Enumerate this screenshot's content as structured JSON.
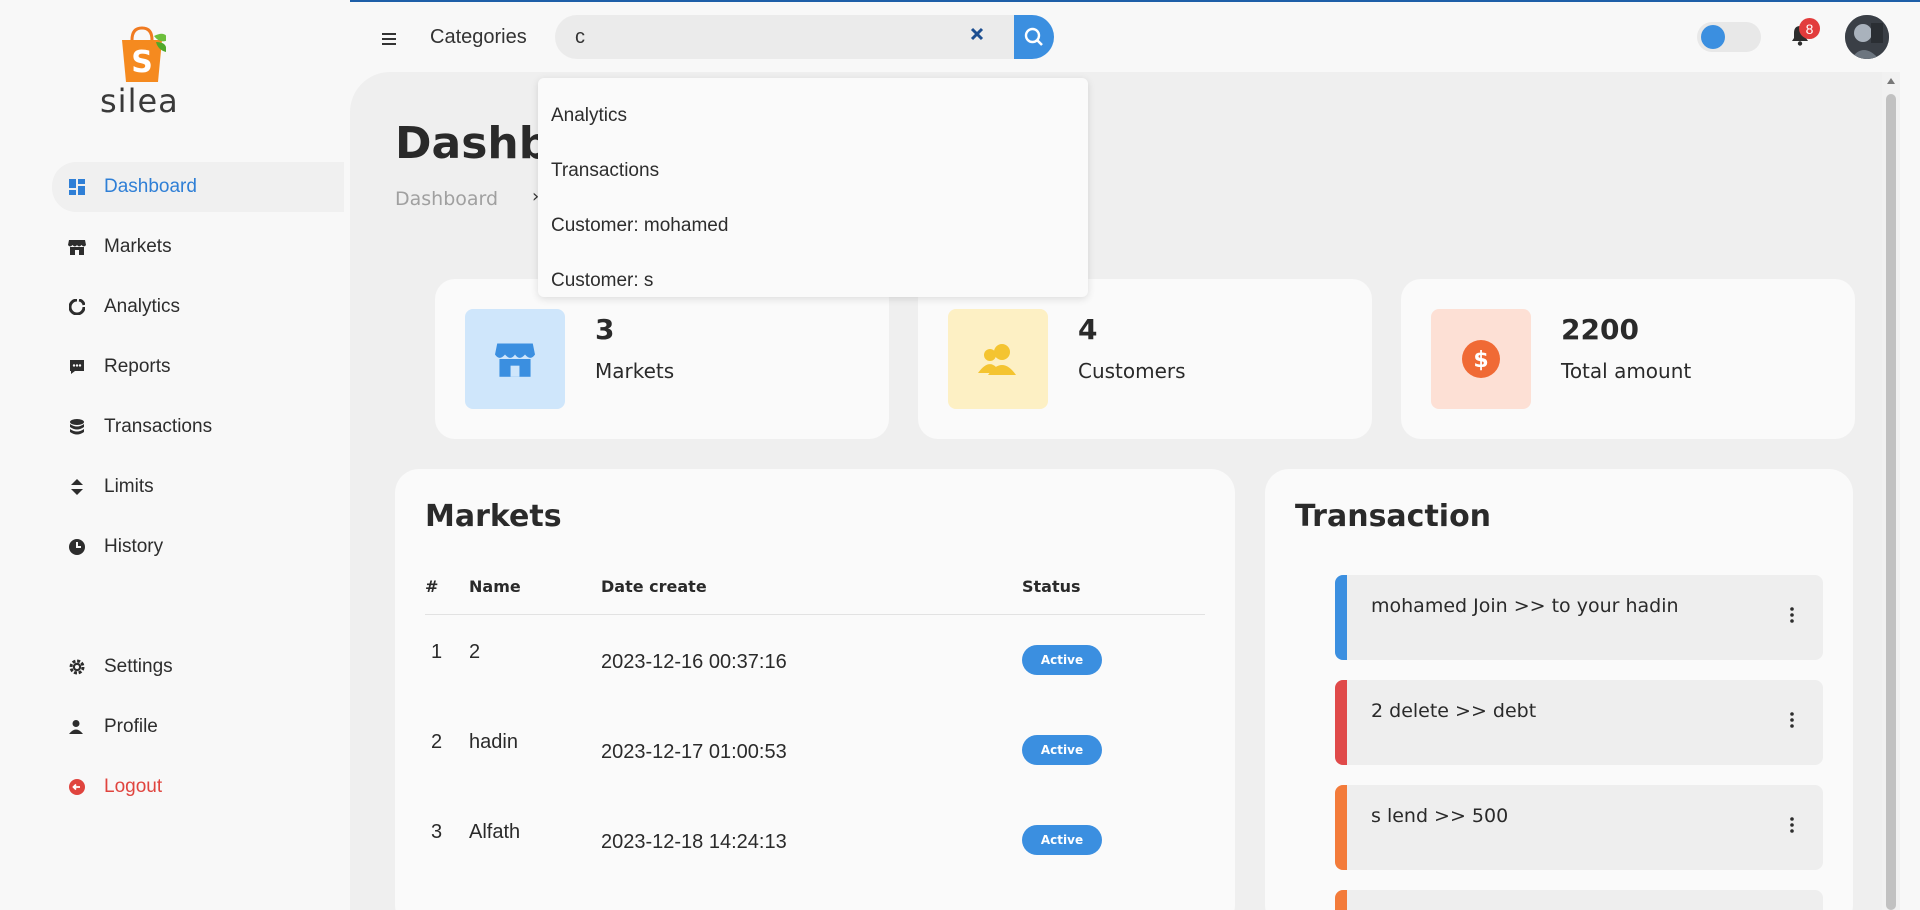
{
  "brand": {
    "name": "silea",
    "bag_letter": "S"
  },
  "sidebar": {
    "items": [
      {
        "label": "Dashboard",
        "icon": "dashboard-icon",
        "active": true
      },
      {
        "label": "Markets",
        "icon": "store-icon"
      },
      {
        "label": "Analytics",
        "icon": "pie-chart-icon"
      },
      {
        "label": "Reports",
        "icon": "report-icon"
      },
      {
        "label": "Transactions",
        "icon": "database-icon"
      },
      {
        "label": "Limits",
        "icon": "sort-icon"
      },
      {
        "label": "History",
        "icon": "clock-icon"
      }
    ],
    "bottom_items": [
      {
        "label": "Settings",
        "icon": "gear-icon"
      },
      {
        "label": "Profile",
        "icon": "user-icon"
      },
      {
        "label": "Logout",
        "icon": "logout-icon"
      }
    ]
  },
  "topbar": {
    "categories_label": "Categories",
    "search_value": "c",
    "notifications_count": "8"
  },
  "search_results": [
    "Analytics",
    "Transactions",
    "Customer: mohamed",
    "Customer: s"
  ],
  "page": {
    "title": "Dashb",
    "breadcrumb": "Dashboard",
    "breadcrumb_sep": "›"
  },
  "stats": [
    {
      "value": "3",
      "label": "Markets",
      "bg": "#cfe6fb",
      "fg": "#3b8fe0"
    },
    {
      "value": "4",
      "label": "Customers",
      "bg": "#fdf0c4",
      "fg": "#f4c430"
    },
    {
      "value": "2200",
      "label": "Total amount",
      "bg": "#fde0d5",
      "fg": "#f06a35"
    }
  ],
  "markets": {
    "title": "Markets",
    "columns": [
      "#",
      "Name",
      "Date create",
      "Status"
    ],
    "rows": [
      {
        "index": "1",
        "name": "2",
        "date": "2023-12-16 00:37:16",
        "status": "Active"
      },
      {
        "index": "2",
        "name": "hadin",
        "date": "2023-12-17 01:00:53",
        "status": "Active"
      },
      {
        "index": "3",
        "name": "Alfath",
        "date": "2023-12-18 14:24:13",
        "status": "Active"
      }
    ]
  },
  "transactions": {
    "title": "Transaction",
    "items": [
      {
        "text": "mohamed Join >> to your hadin",
        "color": "#3b8fe0"
      },
      {
        "text": "2 delete >> debt",
        "color": "#e04a4a"
      },
      {
        "text": "s lend >> 500",
        "color": "#f37b3a"
      }
    ],
    "partial_color": "#f37b3a"
  },
  "colors": {
    "accent": "#3b8fe0",
    "danger": "#e0443e"
  }
}
